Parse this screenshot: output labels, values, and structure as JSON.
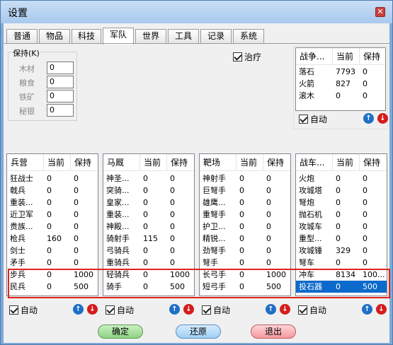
{
  "window": {
    "title": "设置"
  },
  "tabs": [
    "普通",
    "物品",
    "科技",
    "军队",
    "世界",
    "工具",
    "记录",
    "系统"
  ],
  "active_tab": "军队",
  "keep": {
    "legend": "保持(K)",
    "resources": [
      {
        "label": "木材",
        "value": "0"
      },
      {
        "label": "粮食",
        "value": "0"
      },
      {
        "label": "铁矿",
        "value": "0"
      },
      {
        "label": "秘银",
        "value": "0"
      }
    ]
  },
  "heal": {
    "label": "治疗",
    "checked": true
  },
  "war_equipment": {
    "headers": [
      "战争...",
      "当前",
      "保持"
    ],
    "rows": [
      [
        "落石",
        "7793",
        "0"
      ],
      [
        "火箭",
        "827",
        "0"
      ],
      [
        "滚木",
        "0",
        "0"
      ]
    ],
    "auto_label": "自动"
  },
  "lists": [
    {
      "key": "barracks",
      "headers": [
        "兵营",
        "当前",
        "保持"
      ],
      "rows": [
        [
          "狂战士",
          "0",
          "0"
        ],
        [
          "戟兵",
          "0",
          "0"
        ],
        [
          "重装...",
          "0",
          "0"
        ],
        [
          "近卫军",
          "0",
          "0"
        ],
        [
          "贵族...",
          "0",
          "0"
        ],
        [
          "枪兵",
          "160",
          "0"
        ],
        [
          "剑士",
          "0",
          "0"
        ],
        [
          "矛手",
          "0",
          "0"
        ],
        [
          "步兵",
          "0",
          "1000"
        ],
        [
          "民兵",
          "0",
          "500"
        ]
      ],
      "auto_label": "自动"
    },
    {
      "key": "stable",
      "headers": [
        "马厩",
        "当前",
        "保持"
      ],
      "rows": [
        [
          "神圣...",
          "0",
          "0"
        ],
        [
          "突骑...",
          "0",
          "0"
        ],
        [
          "皇家...",
          "0",
          "0"
        ],
        [
          "重装...",
          "0",
          "0"
        ],
        [
          "神殿...",
          "0",
          "0"
        ],
        [
          "骑射手",
          "115",
          "0"
        ],
        [
          "弓骑兵",
          "0",
          "0"
        ],
        [
          "重骑兵",
          "0",
          "0"
        ],
        [
          "轻骑兵",
          "0",
          "1000"
        ],
        [
          "骑手",
          "0",
          "500"
        ]
      ],
      "auto_label": "自动"
    },
    {
      "key": "range",
      "headers": [
        "靶场",
        "当前",
        "保持"
      ],
      "rows": [
        [
          "神射手",
          "0",
          "0"
        ],
        [
          "巨弩手",
          "0",
          "0"
        ],
        [
          "雄鹰...",
          "0",
          "0"
        ],
        [
          "重弩手",
          "0",
          "0"
        ],
        [
          "护卫...",
          "0",
          "0"
        ],
        [
          "精锐...",
          "0",
          "0"
        ],
        [
          "劲弩手",
          "0",
          "0"
        ],
        [
          "弩手",
          "0",
          "0"
        ],
        [
          "长弓手",
          "0",
          "1000"
        ],
        [
          "短弓手",
          "0",
          "500"
        ]
      ],
      "auto_label": "自动"
    },
    {
      "key": "siege",
      "headers": [
        "战车...",
        "当前",
        "保持"
      ],
      "rows": [
        [
          "火炮",
          "0",
          "0"
        ],
        [
          "攻城塔",
          "0",
          "0"
        ],
        [
          "弩炮",
          "0",
          "0"
        ],
        [
          "抛石机",
          "0",
          "0"
        ],
        [
          "攻城车",
          "0",
          "0"
        ],
        [
          "重型...",
          "0",
          "0"
        ],
        [
          "攻城锤",
          "329",
          "0"
        ],
        [
          "弩车",
          "0",
          "0"
        ],
        [
          "冲车",
          "8134",
          "100..."
        ],
        [
          "投石器",
          "0",
          "500"
        ]
      ],
      "selected_row": 9,
      "auto_label": "自动"
    }
  ],
  "buttons": {
    "ok": "确定",
    "restore": "还原",
    "exit": "退出"
  },
  "icons": {
    "up": "arrow-up-circle-icon",
    "down": "arrow-down-circle-icon",
    "close": "close-icon"
  },
  "colors": {
    "highlight_border": "#e0241e",
    "selection": "#0c6acc"
  }
}
